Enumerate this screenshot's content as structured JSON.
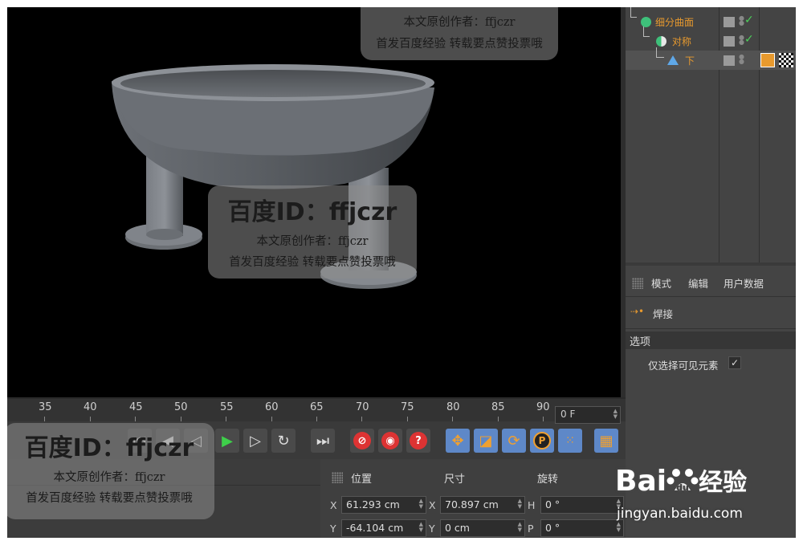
{
  "object_manager": {
    "rows": [
      {
        "label": "细分曲面"
      },
      {
        "label": "对称"
      },
      {
        "label": "下"
      }
    ]
  },
  "attribute_manager": {
    "menu": {
      "mode": "模式",
      "edit": "编辑",
      "user_data": "用户数据"
    },
    "tool_name": "焊接",
    "section": "选项",
    "option_label": "仅选择可见元素",
    "option_checked": "✓"
  },
  "timeline": {
    "ticks": [
      "35",
      "40",
      "45",
      "50",
      "55",
      "60",
      "65",
      "70",
      "75",
      "80",
      "85",
      "90"
    ],
    "current_frame": "0 F"
  },
  "coords": {
    "headers": {
      "position": "位置",
      "size": "尺寸",
      "rotation": "旋转"
    },
    "rows": [
      {
        "axis_pos": "X",
        "pos": "61.293 cm",
        "axis_size": "X",
        "size": "70.897 cm",
        "axis_rot": "H",
        "rot": "0 °"
      },
      {
        "axis_pos": "Y",
        "pos": "-64.104 cm",
        "axis_size": "Y",
        "size": "0 cm",
        "axis_rot": "P",
        "rot": "0 °"
      }
    ]
  },
  "watermark": {
    "id_text": "百度ID：ffjczr",
    "line1": "本文原创作者：ffjczr",
    "line2": "首发百度经验  转载要点赞投票哦"
  },
  "baidu_logo": {
    "brand": "Bai",
    "suffix": "经验",
    "url": "jingyan.baidu.com"
  },
  "colors": {
    "accent_orange": "#e89a2e",
    "active_blue": "#5e88c8",
    "record_red": "#d33333",
    "play_green": "#3ecf4a"
  }
}
